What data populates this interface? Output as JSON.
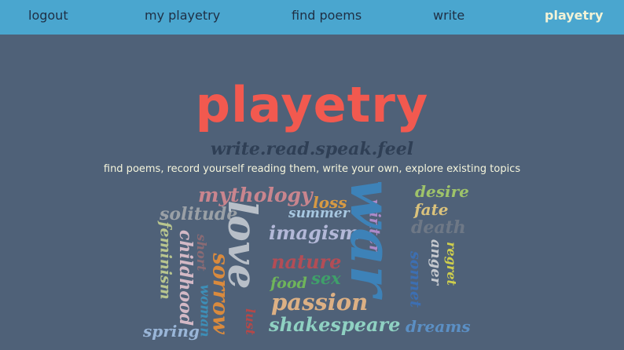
{
  "nav": {
    "logout": "logout",
    "my_playetry": "my playetry",
    "find_poems": "find poems",
    "write": "write",
    "playetry": "playetry"
  },
  "hero": {
    "title": "playetry",
    "tagline": "write.read.speak.feel",
    "description": "find poems, record yourself reading them, write your own, explore existing topics"
  },
  "colors": {
    "nav_bg": "#4aa6cf",
    "page_bg": "#4f6178",
    "brand": "#f2594f",
    "tagline": "#2f3f55",
    "description": "#f5f5dc"
  },
  "cloud": {
    "mythology": "mythology",
    "loss": "loss",
    "desire": "desire",
    "solitude": "solitude",
    "summer": "summer",
    "fate": "fate",
    "death": "death",
    "imagism": "imagism",
    "winter": "winter",
    "love": "love",
    "war": "war",
    "feminism": "feminism",
    "short": "short",
    "childhood": "childhood",
    "sorrow": "sorrow",
    "nature": "nature",
    "sonnet": "sonnet",
    "anger": "anger",
    "regret": "regret",
    "food": "food",
    "sex": "sex",
    "woman": "woman",
    "passion": "passion",
    "lust": "lust",
    "spring": "spring",
    "shakespeare": "shakespeare",
    "dreams": "dreams"
  }
}
